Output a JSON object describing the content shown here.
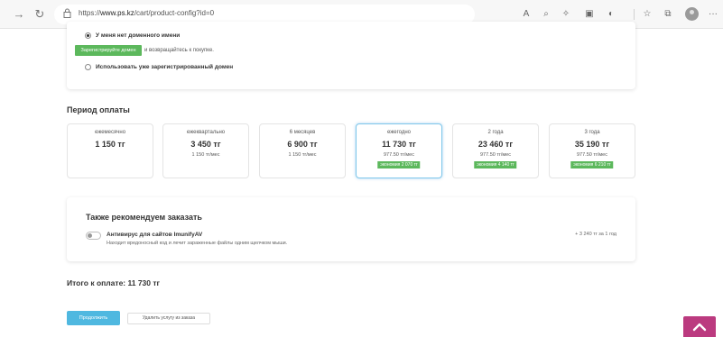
{
  "browser": {
    "url_prefix": "https://",
    "url_host": "www.ps.kz",
    "url_path": "/cart/product-config?id=0",
    "icons": [
      "back-icon",
      "refresh-icon",
      "lock-icon",
      "read-aloud-icon",
      "zoom-icon",
      "extensions-icon",
      "immersive-reader-icon",
      "tracking-icon",
      "favorites-icon",
      "collections-icon",
      "profile-icon",
      "more-icon"
    ]
  },
  "domain": {
    "option_no_domain": "У меня нет доменного имени",
    "register_button": "Зарегистрируйте домен",
    "register_suffix": "и возвращайтесь к покупке.",
    "option_use_existing": "Использовать уже зарегистрированный домен"
  },
  "payment_period": {
    "title": "Период оплаты",
    "options": [
      {
        "label": "ежемесячно",
        "price": "1 150 тг",
        "per_month": "",
        "savings": ""
      },
      {
        "label": "ежеквартально",
        "price": "3 450 тг",
        "per_month": "1 150 тг/мес",
        "savings": ""
      },
      {
        "label": "6 месяцев",
        "price": "6 900 тг",
        "per_month": "1 150 тг/мес",
        "savings": ""
      },
      {
        "label": "ежегодно",
        "price": "11 730 тг",
        "per_month": "977.50 тг/мес",
        "savings": "экономия 2 070 тг"
      },
      {
        "label": "2 года",
        "price": "23 460 тг",
        "per_month": "977.50 тг/мес",
        "savings": "экономия 4 140 тг"
      },
      {
        "label": "3 года",
        "price": "35 190 тг",
        "per_month": "977.50 тг/мес",
        "savings": "экономия 6 210 тг"
      }
    ]
  },
  "recommend": {
    "title": "Также рекомендуем заказать",
    "item_name": "Антивирус для сайтов ImunifyAV",
    "item_desc": "Находит вредоносный код и лечит зараженные файлы одним щелчком мыши.",
    "item_price": "+ 3 240 тг за 1 год"
  },
  "total": "Итого к оплате: 11 730 тг",
  "buttons": {
    "continue": "Продолжить",
    "remove": "Удалить услугу из заказа"
  },
  "colors": {
    "green": "#5cb85c",
    "blue": "#4fb8e0",
    "scroll_top": "#bb3a7f"
  }
}
